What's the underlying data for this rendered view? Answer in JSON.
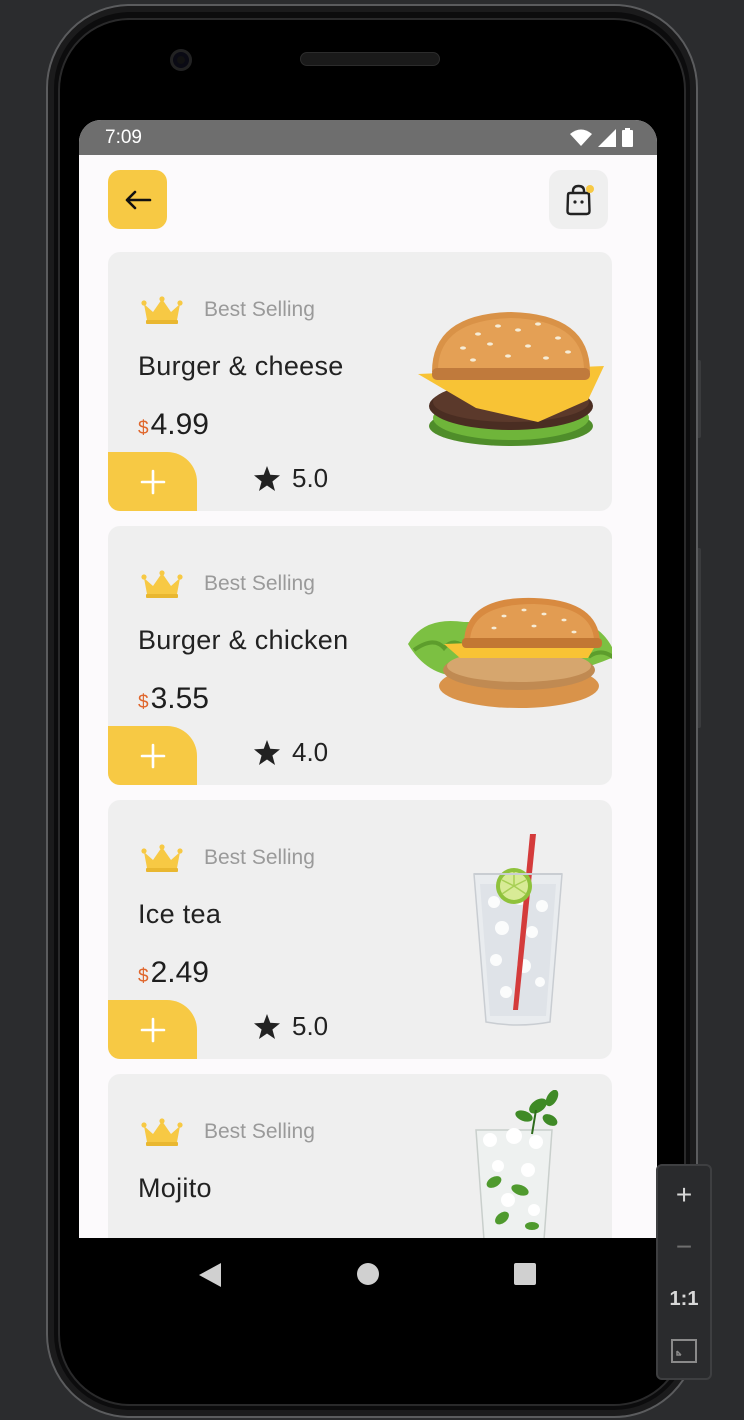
{
  "status_bar": {
    "time": "7:09"
  },
  "header": {
    "back_icon": "arrow-left-icon",
    "cart_icon": "shopping-bag-icon",
    "accent_color": "#f7c944"
  },
  "products": [
    {
      "badge": "Best Selling",
      "name": "Burger & cheese",
      "currency": "$",
      "price": "4.99",
      "rating": "5.0",
      "image": "cheeseburger"
    },
    {
      "badge": "Best Selling",
      "name": "Burger & chicken",
      "currency": "$",
      "price": "3.55",
      "rating": "4.0",
      "image": "chicken-burger"
    },
    {
      "badge": "Best Selling",
      "name": "Ice tea",
      "currency": "$",
      "price": "2.49",
      "rating": "5.0",
      "image": "ice-tea-glass"
    },
    {
      "badge": "Best Selling",
      "name": "Mojito",
      "currency": "$",
      "price": "",
      "rating": "",
      "image": "mojito-glass"
    }
  ],
  "emulator_controls": {
    "zoom_in": "+",
    "zoom_out": "−",
    "actual_size": "1:1"
  }
}
